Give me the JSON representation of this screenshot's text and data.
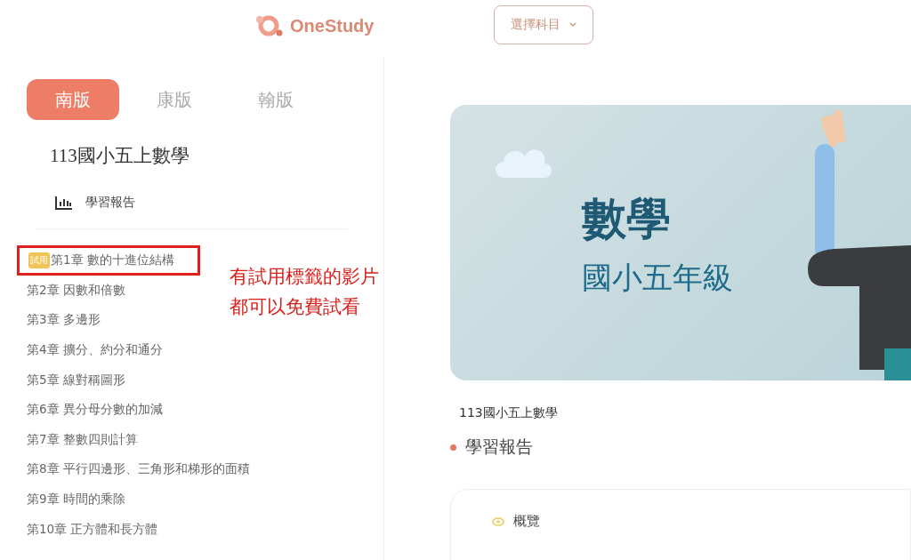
{
  "header": {
    "logo": "OneStudy",
    "subject_select": {
      "label": "選擇科目"
    }
  },
  "sidebar": {
    "tabs": [
      {
        "label": "南版",
        "selected": true
      },
      {
        "label": "康版",
        "selected": false
      },
      {
        "label": "翰版",
        "selected": false
      }
    ],
    "course_title": "113國小五上數學",
    "report_link": "學習報告",
    "chapters": [
      {
        "label": "第1章 數的十進位結構",
        "badge": "試用",
        "highlighted": true
      },
      {
        "label": "第2章 因數和倍數",
        "highlighted": false
      },
      {
        "label": "第3章 多邊形",
        "highlighted": false
      },
      {
        "label": "第4章 擴分、約分和通分",
        "highlighted": false
      },
      {
        "label": "第5章 線對稱圖形",
        "highlighted": false
      },
      {
        "label": "第6章 異分母分數的加減",
        "highlighted": false
      },
      {
        "label": "第7章 整數四則計算",
        "highlighted": false
      },
      {
        "label": "第8章 平行四邊形、三角形和梯形的面積",
        "highlighted": false
      },
      {
        "label": "第9章 時間的乘除",
        "highlighted": false
      },
      {
        "label": "第10章 正方體和長方體",
        "highlighted": false
      }
    ]
  },
  "annotation": {
    "lines": [
      "有試用標籤的影片",
      "都可以免費試看"
    ]
  },
  "main": {
    "banner": {
      "title": "數學",
      "subtitle": "國小五年級"
    },
    "course_title": "113國小五上數學",
    "section_title": "學習報告",
    "card": {
      "tab": "概覽"
    }
  }
}
